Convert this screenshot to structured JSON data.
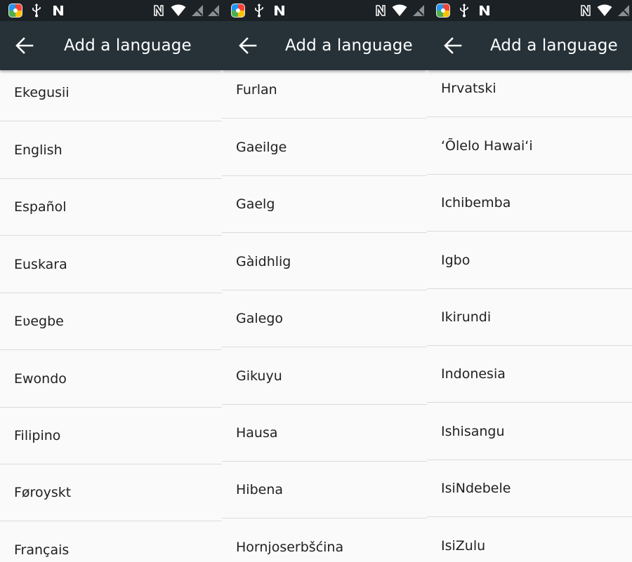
{
  "panels": [
    {
      "title": "Add a language",
      "languages": [
        "Ekegusii",
        "English",
        "Español",
        "Euskara",
        "Eʋegbe",
        "Ewondo",
        "Filipino",
        "Føroyskt",
        "Français"
      ]
    },
    {
      "title": "Add a language",
      "languages": [
        "Furlan",
        "Gaeilge",
        "Gaelg",
        "Gàidhlig",
        "Galego",
        "Gikuyu",
        "Hausa",
        "Hibena",
        "Hornjoserbšćina"
      ]
    },
    {
      "title": "Add a language",
      "languages": [
        "Hrvatski",
        "ʻŌlelo Hawaiʻi",
        "Ichibemba",
        "Igbo",
        "Ikirundi",
        "Indonesia",
        "Ishisangu",
        "IsiNdebele",
        "IsiZulu"
      ]
    }
  ],
  "icons": {
    "back": "arrow-left-icon",
    "status": [
      "app-icon",
      "usb-icon",
      "nfc-icon",
      "nfc-icon",
      "wifi-icon",
      "no-signal-icon",
      "no-signal-icon"
    ]
  },
  "colors": {
    "statusbar": "#1c2125",
    "appbar": "#263238",
    "background": "#fafafa",
    "divider": "#dcdcdc",
    "text": "#212121"
  }
}
